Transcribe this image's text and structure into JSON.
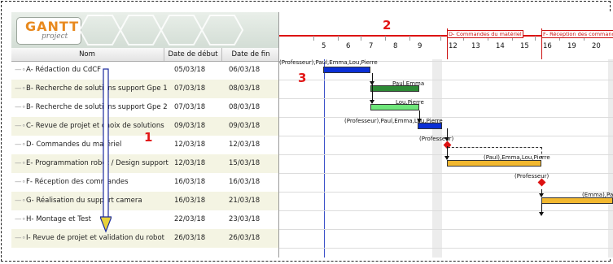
{
  "logo": {
    "text": "GANTT",
    "sub": "project"
  },
  "columns": {
    "name": "Nom",
    "start": "Date de début",
    "end": "Date de fin"
  },
  "tasks": [
    {
      "name": "A- Rédaction du CdCF",
      "start": "05/03/18",
      "end": "06/03/18"
    },
    {
      "name": "B- Recherche de solutions support Gpe 1",
      "start": "07/03/18",
      "end": "08/03/18"
    },
    {
      "name": "B- Recherche de solutions support Gpe 2",
      "start": "07/03/18",
      "end": "08/03/18"
    },
    {
      "name": "C- Revue de projet et choix de solutions",
      "start": "09/03/18",
      "end": "09/03/18"
    },
    {
      "name": "D- Commandes du matériel",
      "start": "12/03/18",
      "end": "12/03/18"
    },
    {
      "name": "E- Programmation robot / Design support",
      "start": "12/03/18",
      "end": "15/03/18"
    },
    {
      "name": "F- Réception des commandes",
      "start": "16/03/18",
      "end": "16/03/18"
    },
    {
      "name": "G- Réalisation du support camera",
      "start": "16/03/18",
      "end": "21/03/18"
    },
    {
      "name": "H- Montage et Test",
      "start": "22/03/18",
      "end": "23/03/18"
    },
    {
      "name": "I- Revue de projet et validation du robot",
      "start": "26/03/18",
      "end": "26/03/18"
    }
  ],
  "timeline": {
    "days": [
      "5",
      "6",
      "7",
      "8",
      "9",
      "12",
      "13",
      "14",
      "15",
      "16",
      "19",
      "20"
    ],
    "milestones": [
      "D- Commandes du matériel",
      "F- Réception des commande"
    ]
  },
  "bar_labels": [
    "(Professeur),Paul,Emma,Lou,Pierre",
    "Paul,Emma",
    "Lou,Pierre",
    "(Professeur),Paul,Emma,Lou,Pierre",
    "(Professeur)",
    "(Paul),Emma,Lou,Pierre",
    "(Professeur)",
    "(Emma),Paul"
  ],
  "annotations": {
    "a1": "1",
    "a2": "2",
    "a3": "3"
  },
  "colors": {
    "blue": "#0a2fd6",
    "green": "#2d8a35",
    "light_green": "#6ee67a",
    "orange": "#f2b830",
    "red": "#d11111",
    "annotation": "#e21616"
  }
}
